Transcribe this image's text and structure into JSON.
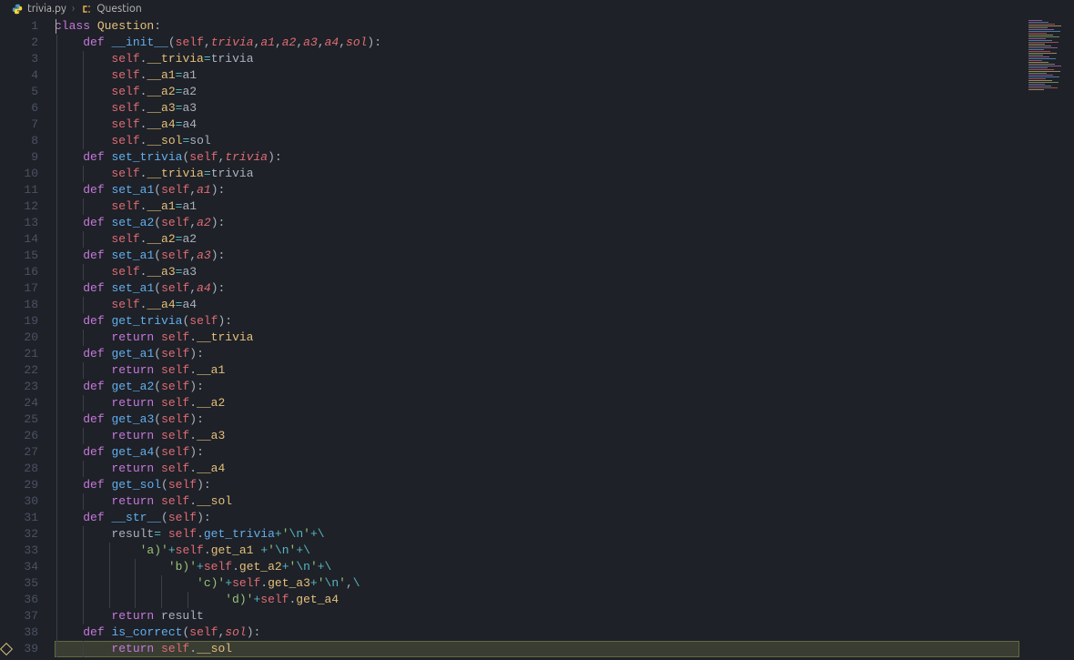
{
  "breadcrumb": {
    "file": "trivia.py",
    "symbol": "Question",
    "chevron": "›"
  },
  "lines": {
    "count": 39,
    "highlighted": 39,
    "warning_line": 39
  },
  "colors": {
    "background": "#1e2127",
    "foreground": "#abb2bf",
    "keyword": "#c678dd",
    "function": "#61afef",
    "class": "#e5c07b",
    "self": "#e06c75",
    "operator": "#56b6c2",
    "string": "#98c379",
    "gutter": "#4b5263",
    "highlight": "rgba(181,189,104,0.18)"
  },
  "code": [
    [
      [
        "kw",
        "class "
      ],
      [
        "cls",
        "Question"
      ],
      [
        "punc",
        ":"
      ]
    ],
    [
      [
        "sp",
        "    "
      ],
      [
        "kw",
        "def "
      ],
      [
        "def",
        "__init__"
      ],
      [
        "punc",
        "("
      ],
      [
        "self",
        "self"
      ],
      [
        "punc",
        ","
      ],
      [
        "param",
        "trivia"
      ],
      [
        "punc",
        ","
      ],
      [
        "param",
        "a1"
      ],
      [
        "punc",
        ","
      ],
      [
        "param",
        "a2"
      ],
      [
        "punc",
        ","
      ],
      [
        "param",
        "a3"
      ],
      [
        "punc",
        ","
      ],
      [
        "param",
        "a4"
      ],
      [
        "punc",
        ","
      ],
      [
        "param",
        "sol"
      ],
      [
        "punc",
        "):"
      ]
    ],
    [
      [
        "sp",
        "        "
      ],
      [
        "self",
        "self"
      ],
      [
        "punc",
        "."
      ],
      [
        "var",
        "__trivia"
      ],
      [
        "op",
        "="
      ],
      [
        "punc",
        "trivia"
      ]
    ],
    [
      [
        "sp",
        "        "
      ],
      [
        "self",
        "self"
      ],
      [
        "punc",
        "."
      ],
      [
        "var",
        "__a1"
      ],
      [
        "op",
        "="
      ],
      [
        "punc",
        "a1"
      ]
    ],
    [
      [
        "sp",
        "        "
      ],
      [
        "self",
        "self"
      ],
      [
        "punc",
        "."
      ],
      [
        "var",
        "__a2"
      ],
      [
        "op",
        "="
      ],
      [
        "punc",
        "a2"
      ]
    ],
    [
      [
        "sp",
        "        "
      ],
      [
        "self",
        "self"
      ],
      [
        "punc",
        "."
      ],
      [
        "var",
        "__a3"
      ],
      [
        "op",
        "="
      ],
      [
        "punc",
        "a3"
      ]
    ],
    [
      [
        "sp",
        "        "
      ],
      [
        "self",
        "self"
      ],
      [
        "punc",
        "."
      ],
      [
        "var",
        "__a4"
      ],
      [
        "op",
        "="
      ],
      [
        "punc",
        "a4"
      ]
    ],
    [
      [
        "sp",
        "        "
      ],
      [
        "self",
        "self"
      ],
      [
        "punc",
        "."
      ],
      [
        "var",
        "__sol"
      ],
      [
        "op",
        "="
      ],
      [
        "punc",
        "sol"
      ]
    ],
    [
      [
        "sp",
        "    "
      ],
      [
        "kw",
        "def "
      ],
      [
        "fn",
        "set_trivia"
      ],
      [
        "punc",
        "("
      ],
      [
        "self",
        "self"
      ],
      [
        "punc",
        ","
      ],
      [
        "param",
        "trivia"
      ],
      [
        "punc",
        "):"
      ]
    ],
    [
      [
        "sp",
        "        "
      ],
      [
        "self",
        "self"
      ],
      [
        "punc",
        "."
      ],
      [
        "var",
        "__trivia"
      ],
      [
        "op",
        "="
      ],
      [
        "punc",
        "trivia"
      ]
    ],
    [
      [
        "sp",
        "    "
      ],
      [
        "kw",
        "def "
      ],
      [
        "fn",
        "set_a1"
      ],
      [
        "punc",
        "("
      ],
      [
        "self",
        "self"
      ],
      [
        "punc",
        ","
      ],
      [
        "param",
        "a1"
      ],
      [
        "punc",
        "):"
      ]
    ],
    [
      [
        "sp",
        "        "
      ],
      [
        "self",
        "self"
      ],
      [
        "punc",
        "."
      ],
      [
        "var",
        "__a1"
      ],
      [
        "op",
        "="
      ],
      [
        "punc",
        "a1"
      ]
    ],
    [
      [
        "sp",
        "    "
      ],
      [
        "kw",
        "def "
      ],
      [
        "fn",
        "set_a2"
      ],
      [
        "punc",
        "("
      ],
      [
        "self",
        "self"
      ],
      [
        "punc",
        ","
      ],
      [
        "param",
        "a2"
      ],
      [
        "punc",
        "):"
      ]
    ],
    [
      [
        "sp",
        "        "
      ],
      [
        "self",
        "self"
      ],
      [
        "punc",
        "."
      ],
      [
        "var",
        "__a2"
      ],
      [
        "op",
        "="
      ],
      [
        "punc",
        "a2"
      ]
    ],
    [
      [
        "sp",
        "    "
      ],
      [
        "kw",
        "def "
      ],
      [
        "fn",
        "set_a1"
      ],
      [
        "punc",
        "("
      ],
      [
        "self",
        "self"
      ],
      [
        "punc",
        ","
      ],
      [
        "param",
        "a3"
      ],
      [
        "punc",
        "):"
      ]
    ],
    [
      [
        "sp",
        "        "
      ],
      [
        "self",
        "self"
      ],
      [
        "punc",
        "."
      ],
      [
        "var",
        "__a3"
      ],
      [
        "op",
        "="
      ],
      [
        "punc",
        "a3"
      ]
    ],
    [
      [
        "sp",
        "    "
      ],
      [
        "kw",
        "def "
      ],
      [
        "fn",
        "set_a1"
      ],
      [
        "punc",
        "("
      ],
      [
        "self",
        "self"
      ],
      [
        "punc",
        ","
      ],
      [
        "param",
        "a4"
      ],
      [
        "punc",
        "):"
      ]
    ],
    [
      [
        "sp",
        "        "
      ],
      [
        "self",
        "self"
      ],
      [
        "punc",
        "."
      ],
      [
        "var",
        "__a4"
      ],
      [
        "op",
        "="
      ],
      [
        "punc",
        "a4"
      ]
    ],
    [
      [
        "sp",
        "    "
      ],
      [
        "kw",
        "def "
      ],
      [
        "fn",
        "get_trivia"
      ],
      [
        "punc",
        "("
      ],
      [
        "self",
        "self"
      ],
      [
        "punc",
        "):"
      ]
    ],
    [
      [
        "sp",
        "        "
      ],
      [
        "kw",
        "return "
      ],
      [
        "self",
        "self"
      ],
      [
        "punc",
        "."
      ],
      [
        "var",
        "__trivia"
      ]
    ],
    [
      [
        "sp",
        "    "
      ],
      [
        "kw",
        "def "
      ],
      [
        "fn",
        "get_a1"
      ],
      [
        "punc",
        "("
      ],
      [
        "self",
        "self"
      ],
      [
        "punc",
        "):"
      ]
    ],
    [
      [
        "sp",
        "        "
      ],
      [
        "kw",
        "return "
      ],
      [
        "self",
        "self"
      ],
      [
        "punc",
        "."
      ],
      [
        "var",
        "__a1"
      ]
    ],
    [
      [
        "sp",
        "    "
      ],
      [
        "kw",
        "def "
      ],
      [
        "fn",
        "get_a2"
      ],
      [
        "punc",
        "("
      ],
      [
        "self",
        "self"
      ],
      [
        "punc",
        "):"
      ]
    ],
    [
      [
        "sp",
        "        "
      ],
      [
        "kw",
        "return "
      ],
      [
        "self",
        "self"
      ],
      [
        "punc",
        "."
      ],
      [
        "var",
        "__a2"
      ]
    ],
    [
      [
        "sp",
        "    "
      ],
      [
        "kw",
        "def "
      ],
      [
        "fn",
        "get_a3"
      ],
      [
        "punc",
        "("
      ],
      [
        "self",
        "self"
      ],
      [
        "punc",
        "):"
      ]
    ],
    [
      [
        "sp",
        "        "
      ],
      [
        "kw",
        "return "
      ],
      [
        "self",
        "self"
      ],
      [
        "punc",
        "."
      ],
      [
        "var",
        "__a3"
      ]
    ],
    [
      [
        "sp",
        "    "
      ],
      [
        "kw",
        "def "
      ],
      [
        "fn",
        "get_a4"
      ],
      [
        "punc",
        "("
      ],
      [
        "self",
        "self"
      ],
      [
        "punc",
        "):"
      ]
    ],
    [
      [
        "sp",
        "        "
      ],
      [
        "kw",
        "return "
      ],
      [
        "self",
        "self"
      ],
      [
        "punc",
        "."
      ],
      [
        "var",
        "__a4"
      ]
    ],
    [
      [
        "sp",
        "    "
      ],
      [
        "kw",
        "def "
      ],
      [
        "fn",
        "get_sol"
      ],
      [
        "punc",
        "("
      ],
      [
        "self",
        "self"
      ],
      [
        "punc",
        "):"
      ]
    ],
    [
      [
        "sp",
        "        "
      ],
      [
        "kw",
        "return "
      ],
      [
        "self",
        "self"
      ],
      [
        "punc",
        "."
      ],
      [
        "var",
        "__sol"
      ]
    ],
    [
      [
        "sp",
        "    "
      ],
      [
        "kw",
        "def "
      ],
      [
        "def",
        "__str__"
      ],
      [
        "punc",
        "("
      ],
      [
        "self",
        "self"
      ],
      [
        "punc",
        "):"
      ]
    ],
    [
      [
        "sp",
        "        "
      ],
      [
        "punc",
        "result"
      ],
      [
        "op",
        "= "
      ],
      [
        "self",
        "self"
      ],
      [
        "punc",
        "."
      ],
      [
        "fn",
        "get_trivia"
      ],
      [
        "op",
        "+"
      ],
      [
        "str",
        "'"
      ],
      [
        "esc",
        "\\n"
      ],
      [
        "str",
        "'"
      ],
      [
        "op",
        "+\\"
      ]
    ],
    [
      [
        "sp",
        "            "
      ],
      [
        "str",
        "'a)'"
      ],
      [
        "op",
        "+"
      ],
      [
        "self",
        "self"
      ],
      [
        "punc",
        "."
      ],
      [
        "var",
        "get_a1"
      ],
      [
        "punc",
        " "
      ],
      [
        "op",
        "+"
      ],
      [
        "str",
        "'"
      ],
      [
        "esc",
        "\\n"
      ],
      [
        "str",
        "'"
      ],
      [
        "op",
        "+\\"
      ]
    ],
    [
      [
        "sp",
        "                "
      ],
      [
        "str",
        "'b)'"
      ],
      [
        "op",
        "+"
      ],
      [
        "self",
        "self"
      ],
      [
        "punc",
        "."
      ],
      [
        "var",
        "get_a2"
      ],
      [
        "op",
        "+"
      ],
      [
        "str",
        "'"
      ],
      [
        "esc",
        "\\n"
      ],
      [
        "str",
        "'"
      ],
      [
        "op",
        "+\\"
      ]
    ],
    [
      [
        "sp",
        "                    "
      ],
      [
        "str",
        "'c)'"
      ],
      [
        "op",
        "+"
      ],
      [
        "self",
        "self"
      ],
      [
        "punc",
        "."
      ],
      [
        "var",
        "get_a3"
      ],
      [
        "op",
        "+"
      ],
      [
        "str",
        "'"
      ],
      [
        "esc",
        "\\n"
      ],
      [
        "str",
        "'"
      ],
      [
        "punc",
        ","
      ],
      [
        "op",
        "\\"
      ]
    ],
    [
      [
        "sp",
        "                        "
      ],
      [
        "str",
        "'d)'"
      ],
      [
        "op",
        "+"
      ],
      [
        "self",
        "self"
      ],
      [
        "punc",
        "."
      ],
      [
        "var",
        "get_a4"
      ]
    ],
    [
      [
        "sp",
        "        "
      ],
      [
        "kw",
        "return "
      ],
      [
        "punc",
        "result"
      ]
    ],
    [
      [
        "sp",
        "    "
      ],
      [
        "kw",
        "def "
      ],
      [
        "fn",
        "is_correct"
      ],
      [
        "punc",
        "("
      ],
      [
        "self",
        "self"
      ],
      [
        "punc",
        ","
      ],
      [
        "param",
        "sol"
      ],
      [
        "punc",
        "):"
      ]
    ],
    [
      [
        "sp",
        "        "
      ],
      [
        "kw",
        "return "
      ],
      [
        "self",
        "self"
      ],
      [
        "punc",
        "."
      ],
      [
        "var",
        "__sol"
      ]
    ]
  ]
}
